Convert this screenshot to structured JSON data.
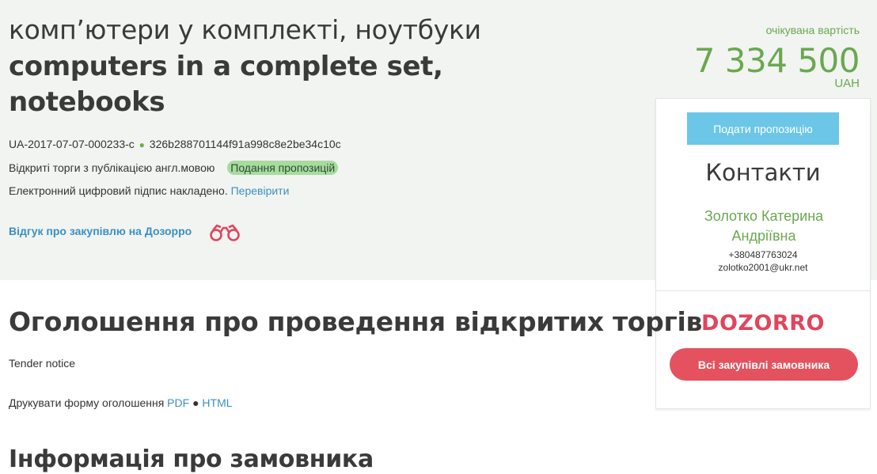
{
  "tender": {
    "title_ua": "комп’ютери у комплекті, ноутбуки",
    "title_en": "computers in a complete set, notebooks",
    "id": "UA-2017-07-07-000233-c",
    "hash": "326b288701144f91a998c8e2be34c10c",
    "procedure": "Відкриті торги з публікацією англ.мовою",
    "status": "Подання пропозицій",
    "signature_text": "Електронний цифровий підпис накладено.",
    "verify_link": "Перевірити",
    "dozorro_feedback": "Відгук про закупівлю на Дозорро"
  },
  "price": {
    "label": "очікувана вартість",
    "value": "7 334 500",
    "currency": "UAH"
  },
  "sidebar": {
    "submit_button": "Подати пропозицію",
    "contacts_title": "Контакти",
    "contact_name": "Золотко Катерина Андріївна",
    "contact_phone": "+380487763024",
    "contact_email": "zolotko2001@ukr.net",
    "dozorro_logo": "DOZORRO",
    "all_purchases_button": "Всі закупівлі замовника"
  },
  "notice": {
    "title": "Оголошення про проведення відкритих торгів",
    "subtitle": "Tender notice",
    "print_label": "Друкувати форму оголошення",
    "pdf_link": "PDF",
    "html_link": "HTML"
  },
  "customer": {
    "title": "Інформація про замовника"
  },
  "colors": {
    "accent_green": "#6aa84f",
    "link_blue": "#3b8fc4",
    "dozorro_red": "#e2445c",
    "submit_blue": "#6cc6e8"
  }
}
